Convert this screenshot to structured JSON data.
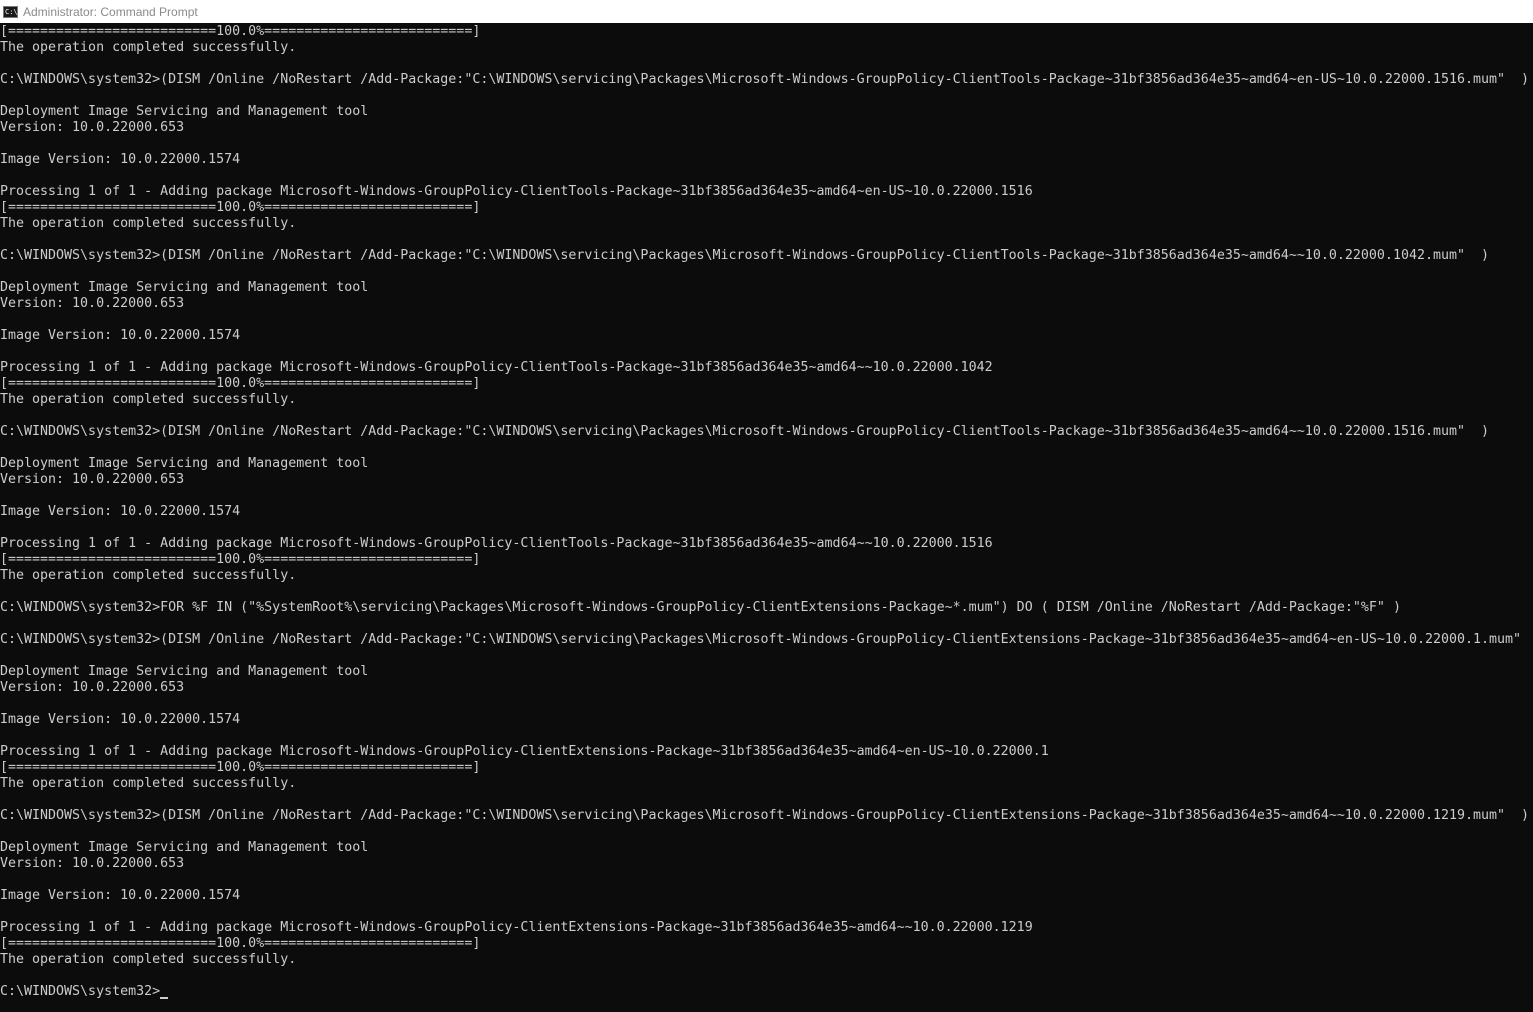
{
  "window": {
    "title": "Administrator: Command Prompt",
    "icon": "cmd-console-icon",
    "icon_glyph": "C:\\",
    "colors": {
      "background": "#0c0c0c",
      "text": "#cccccc",
      "titlebar": "#ffffff",
      "title_text": "#8a8a8a"
    }
  },
  "console": {
    "lines": [
      "[==========================100.0%==========================]",
      "The operation completed successfully.",
      "",
      "C:\\WINDOWS\\system32>(DISM /Online /NoRestart /Add-Package:\"C:\\WINDOWS\\servicing\\Packages\\Microsoft-Windows-GroupPolicy-ClientTools-Package~31bf3856ad364e35~amd64~en-US~10.0.22000.1516.mum\"  )",
      "",
      "Deployment Image Servicing and Management tool",
      "Version: 10.0.22000.653",
      "",
      "Image Version: 10.0.22000.1574",
      "",
      "Processing 1 of 1 - Adding package Microsoft-Windows-GroupPolicy-ClientTools-Package~31bf3856ad364e35~amd64~en-US~10.0.22000.1516",
      "[==========================100.0%==========================]",
      "The operation completed successfully.",
      "",
      "C:\\WINDOWS\\system32>(DISM /Online /NoRestart /Add-Package:\"C:\\WINDOWS\\servicing\\Packages\\Microsoft-Windows-GroupPolicy-ClientTools-Package~31bf3856ad364e35~amd64~~10.0.22000.1042.mum\"  )",
      "",
      "Deployment Image Servicing and Management tool",
      "Version: 10.0.22000.653",
      "",
      "Image Version: 10.0.22000.1574",
      "",
      "Processing 1 of 1 - Adding package Microsoft-Windows-GroupPolicy-ClientTools-Package~31bf3856ad364e35~amd64~~10.0.22000.1042",
      "[==========================100.0%==========================]",
      "The operation completed successfully.",
      "",
      "C:\\WINDOWS\\system32>(DISM /Online /NoRestart /Add-Package:\"C:\\WINDOWS\\servicing\\Packages\\Microsoft-Windows-GroupPolicy-ClientTools-Package~31bf3856ad364e35~amd64~~10.0.22000.1516.mum\"  )",
      "",
      "Deployment Image Servicing and Management tool",
      "Version: 10.0.22000.653",
      "",
      "Image Version: 10.0.22000.1574",
      "",
      "Processing 1 of 1 - Adding package Microsoft-Windows-GroupPolicy-ClientTools-Package~31bf3856ad364e35~amd64~~10.0.22000.1516",
      "[==========================100.0%==========================]",
      "The operation completed successfully.",
      "",
      "C:\\WINDOWS\\system32>FOR %F IN (\"%SystemRoot%\\servicing\\Packages\\Microsoft-Windows-GroupPolicy-ClientExtensions-Package~*.mum\") DO ( DISM /Online /NoRestart /Add-Package:\"%F\" )",
      "",
      "C:\\WINDOWS\\system32>(DISM /Online /NoRestart /Add-Package:\"C:\\WINDOWS\\servicing\\Packages\\Microsoft-Windows-GroupPolicy-ClientExtensions-Package~31bf3856ad364e35~amd64~en-US~10.0.22000.1.mum\"",
      "",
      "Deployment Image Servicing and Management tool",
      "Version: 10.0.22000.653",
      "",
      "Image Version: 10.0.22000.1574",
      "",
      "Processing 1 of 1 - Adding package Microsoft-Windows-GroupPolicy-ClientExtensions-Package~31bf3856ad364e35~amd64~en-US~10.0.22000.1",
      "[==========================100.0%==========================]",
      "The operation completed successfully.",
      "",
      "C:\\WINDOWS\\system32>(DISM /Online /NoRestart /Add-Package:\"C:\\WINDOWS\\servicing\\Packages\\Microsoft-Windows-GroupPolicy-ClientExtensions-Package~31bf3856ad364e35~amd64~~10.0.22000.1219.mum\"  )",
      "",
      "Deployment Image Servicing and Management tool",
      "Version: 10.0.22000.653",
      "",
      "Image Version: 10.0.22000.1574",
      "",
      "Processing 1 of 1 - Adding package Microsoft-Windows-GroupPolicy-ClientExtensions-Package~31bf3856ad364e35~amd64~~10.0.22000.1219",
      "[==========================100.0%==========================]",
      "The operation completed successfully.",
      "",
      "C:\\WINDOWS\\system32>"
    ]
  }
}
